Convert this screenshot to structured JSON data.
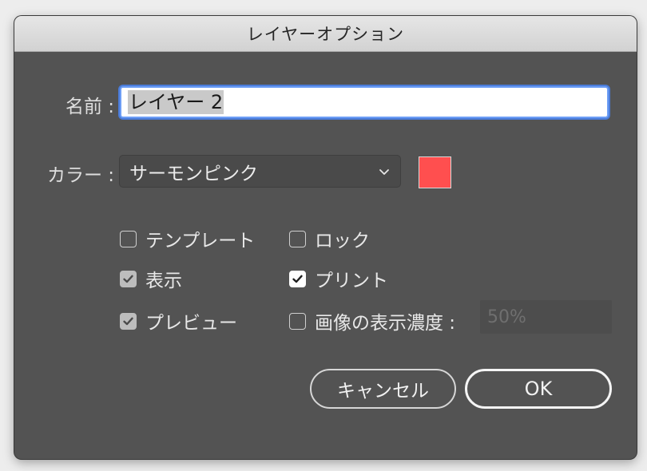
{
  "dialog": {
    "title": "レイヤーオプション"
  },
  "name_field": {
    "label": "名前 :",
    "value": "レイヤー 2"
  },
  "color_field": {
    "label": "カラー :",
    "selected": "サーモンピンク",
    "swatch_color": "#ff4f4f"
  },
  "options": {
    "template": {
      "label": "テンプレート",
      "checked": false
    },
    "lock": {
      "label": "ロック",
      "checked": false
    },
    "show": {
      "label": "表示",
      "checked": true
    },
    "print": {
      "label": "プリント",
      "checked": true
    },
    "preview": {
      "label": "プレビュー",
      "checked": true
    },
    "dim_images": {
      "label": "画像の表示濃度 :",
      "checked": false,
      "value": "50%"
    }
  },
  "buttons": {
    "cancel": "キャンセル",
    "ok": "OK"
  }
}
